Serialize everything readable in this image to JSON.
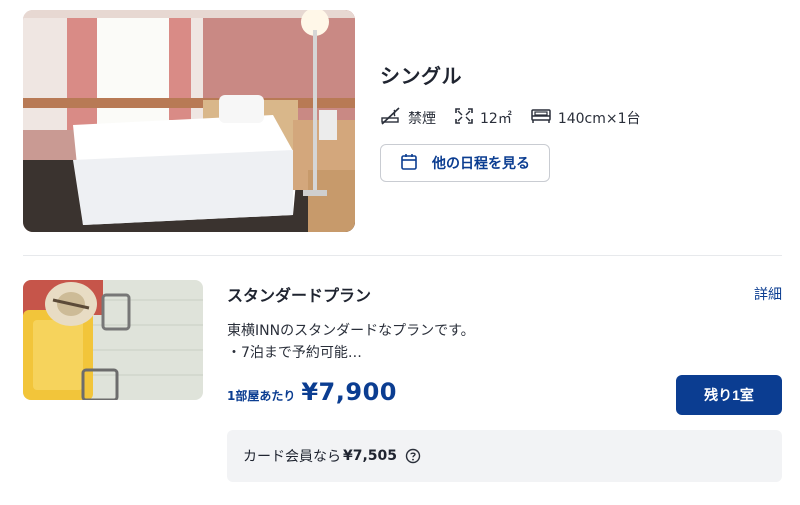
{
  "room": {
    "title": "シングル",
    "smoking": "禁煙",
    "area": "12㎡",
    "bed": "140cm×1台",
    "schedule_button": "他の日程を見る"
  },
  "plan": {
    "title": "スタンダードプラン",
    "details_link": "詳細",
    "description_line1": "東横INNのスタンダードなプランです。",
    "description_line2": "・7泊まで予約可能…",
    "per_room_label": "1部屋あたり",
    "price": "¥7,900",
    "rooms_left_button": "残り1室",
    "member_label": "カード会員なら",
    "member_price": "¥7,505"
  },
  "colors": {
    "accent": "#0b3d91",
    "text": "#1f2430",
    "panel": "#f2f3f5"
  },
  "icons": [
    "no-smoking-icon",
    "expand-icon",
    "bed-icon",
    "calendar-icon",
    "help-icon"
  ]
}
